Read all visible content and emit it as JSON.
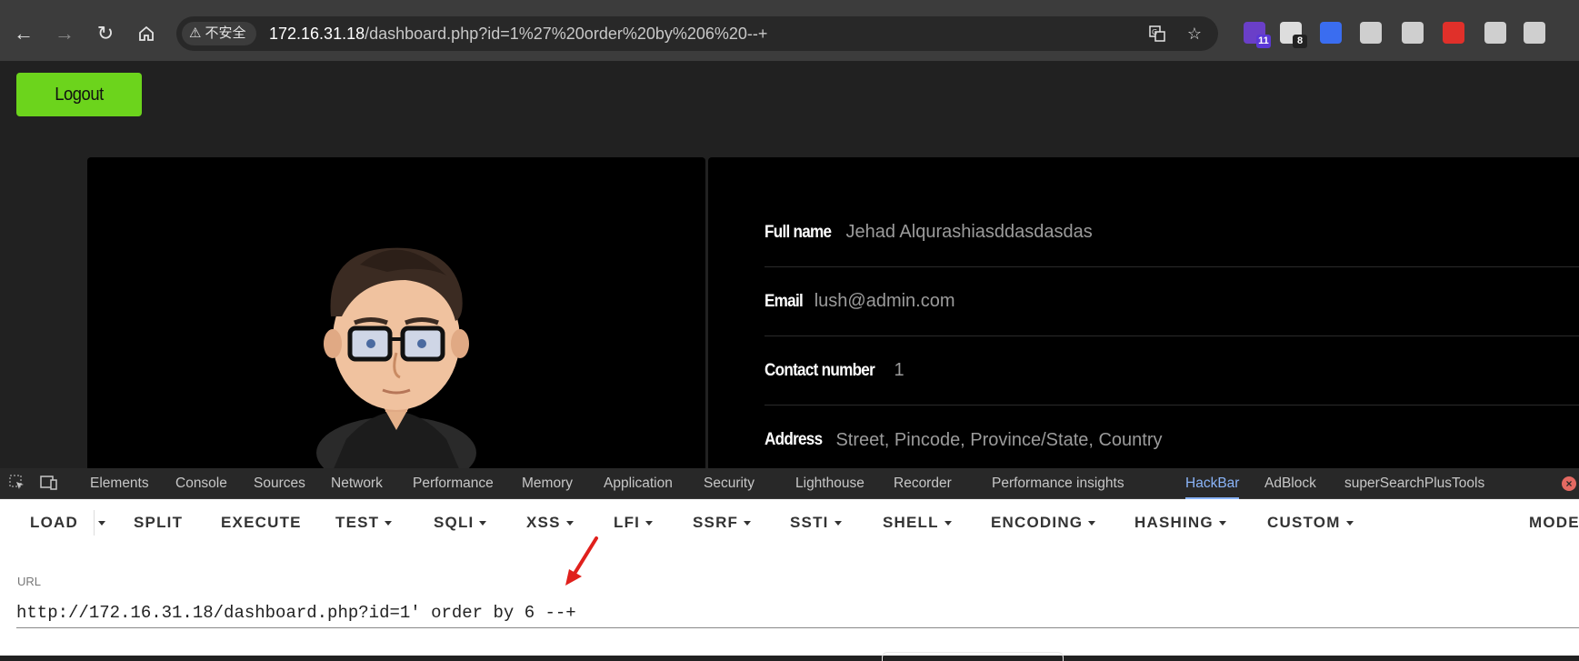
{
  "browser": {
    "security_label": "不安全",
    "url_host": "172.16.31.18",
    "url_rest": "/dashboard.php?id=1%27%20order%20by%206%20--+",
    "extensions": [
      {
        "name": "ext-1",
        "badge": "11",
        "color": "#6a3fc8"
      },
      {
        "name": "ext-2",
        "badge": "8",
        "color": "#dddddd"
      },
      {
        "name": "ext-3",
        "badge": "",
        "color": "#3a6df0"
      },
      {
        "name": "ext-4",
        "badge": "",
        "color": "#cfcfcf"
      },
      {
        "name": "ext-5",
        "badge": "",
        "color": "#cfcfcf"
      },
      {
        "name": "ext-6",
        "badge": "",
        "color": "#e0302a"
      },
      {
        "name": "ext-7",
        "badge": "",
        "color": "#cfcfcf"
      },
      {
        "name": "ext-8",
        "badge": "",
        "color": "#cfcfcf"
      }
    ]
  },
  "page": {
    "logout_label": "Logout",
    "fields": [
      {
        "label": "Full name",
        "value": "Jehad Alqurashiasddasdasdas"
      },
      {
        "label": "Email",
        "value": "lush@admin.com"
      },
      {
        "label": "Contact number",
        "value": "1"
      },
      {
        "label": "Address",
        "value": "Street, Pincode, Province/State, Country"
      }
    ]
  },
  "devtools": {
    "tabs": [
      "Elements",
      "Console",
      "Sources",
      "Network",
      "Performance",
      "Memory",
      "Application",
      "Security",
      "Lighthouse",
      "Recorder",
      "Performance insights",
      "HackBar",
      "AdBlock",
      "superSearchPlusTools"
    ],
    "active_tab": "HackBar"
  },
  "hackbar": {
    "buttons": [
      "LOAD",
      "SPLIT",
      "EXECUTE",
      "TEST",
      "SQLI",
      "XSS",
      "LFI",
      "SSRF",
      "SSTI",
      "SHELL",
      "ENCODING",
      "HASHING",
      "CUSTOM",
      "MODE"
    ],
    "url_label": "URL",
    "url_value": "http://172.16.31.18/dashboard.php?id=1' order by 6 --+"
  },
  "colors": {
    "accent_green": "#6cd41c",
    "arrow_red": "#e0201c",
    "active_tab": "#8ab4f8"
  }
}
